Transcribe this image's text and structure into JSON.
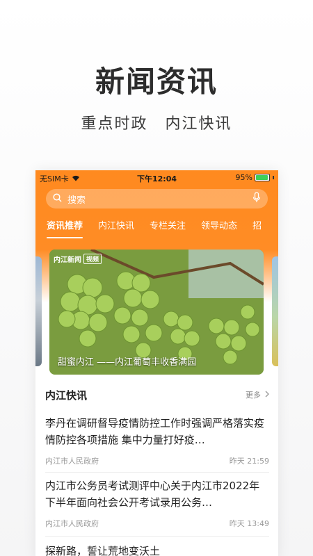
{
  "hero": {
    "title": "新闻资讯",
    "subtitle": "重点时政 内江快讯"
  },
  "status_bar": {
    "carrier": "无SIM卡",
    "time": "下午12:04",
    "battery": "95%",
    "battery_level": 0.95
  },
  "search": {
    "placeholder": "搜索"
  },
  "tabs": [
    {
      "label": "资讯推荐",
      "active": true
    },
    {
      "label": "内江快讯",
      "active": false
    },
    {
      "label": "专栏关注",
      "active": false
    },
    {
      "label": "领导动态",
      "active": false
    },
    {
      "label": "招",
      "active": false
    }
  ],
  "banner": {
    "logo_text": "内江新闻",
    "logo_tag": "视频",
    "caption": "甜蜜内江 ——内江葡萄丰收香满园"
  },
  "section": {
    "title": "内江快讯",
    "more_label": "更多"
  },
  "news": [
    {
      "title": "李丹在调研督导疫情防控工作时强调严格落实疫情防控各项措施 集中力量打好疫…",
      "source": "内江市人民政府",
      "time": "昨天 21:59"
    },
    {
      "title": "内江市公务员考试测评中心关于内江市2022年下半年面向社会公开考试录用公务…",
      "source": "内江市人民政府",
      "time": "昨天 13:49"
    },
    {
      "title": "探新路，誓让荒地变沃土",
      "source": "",
      "time": ""
    }
  ],
  "colors": {
    "brand_orange": "#ff8a1f",
    "text_dark": "#222222",
    "text_muted": "#999999"
  }
}
